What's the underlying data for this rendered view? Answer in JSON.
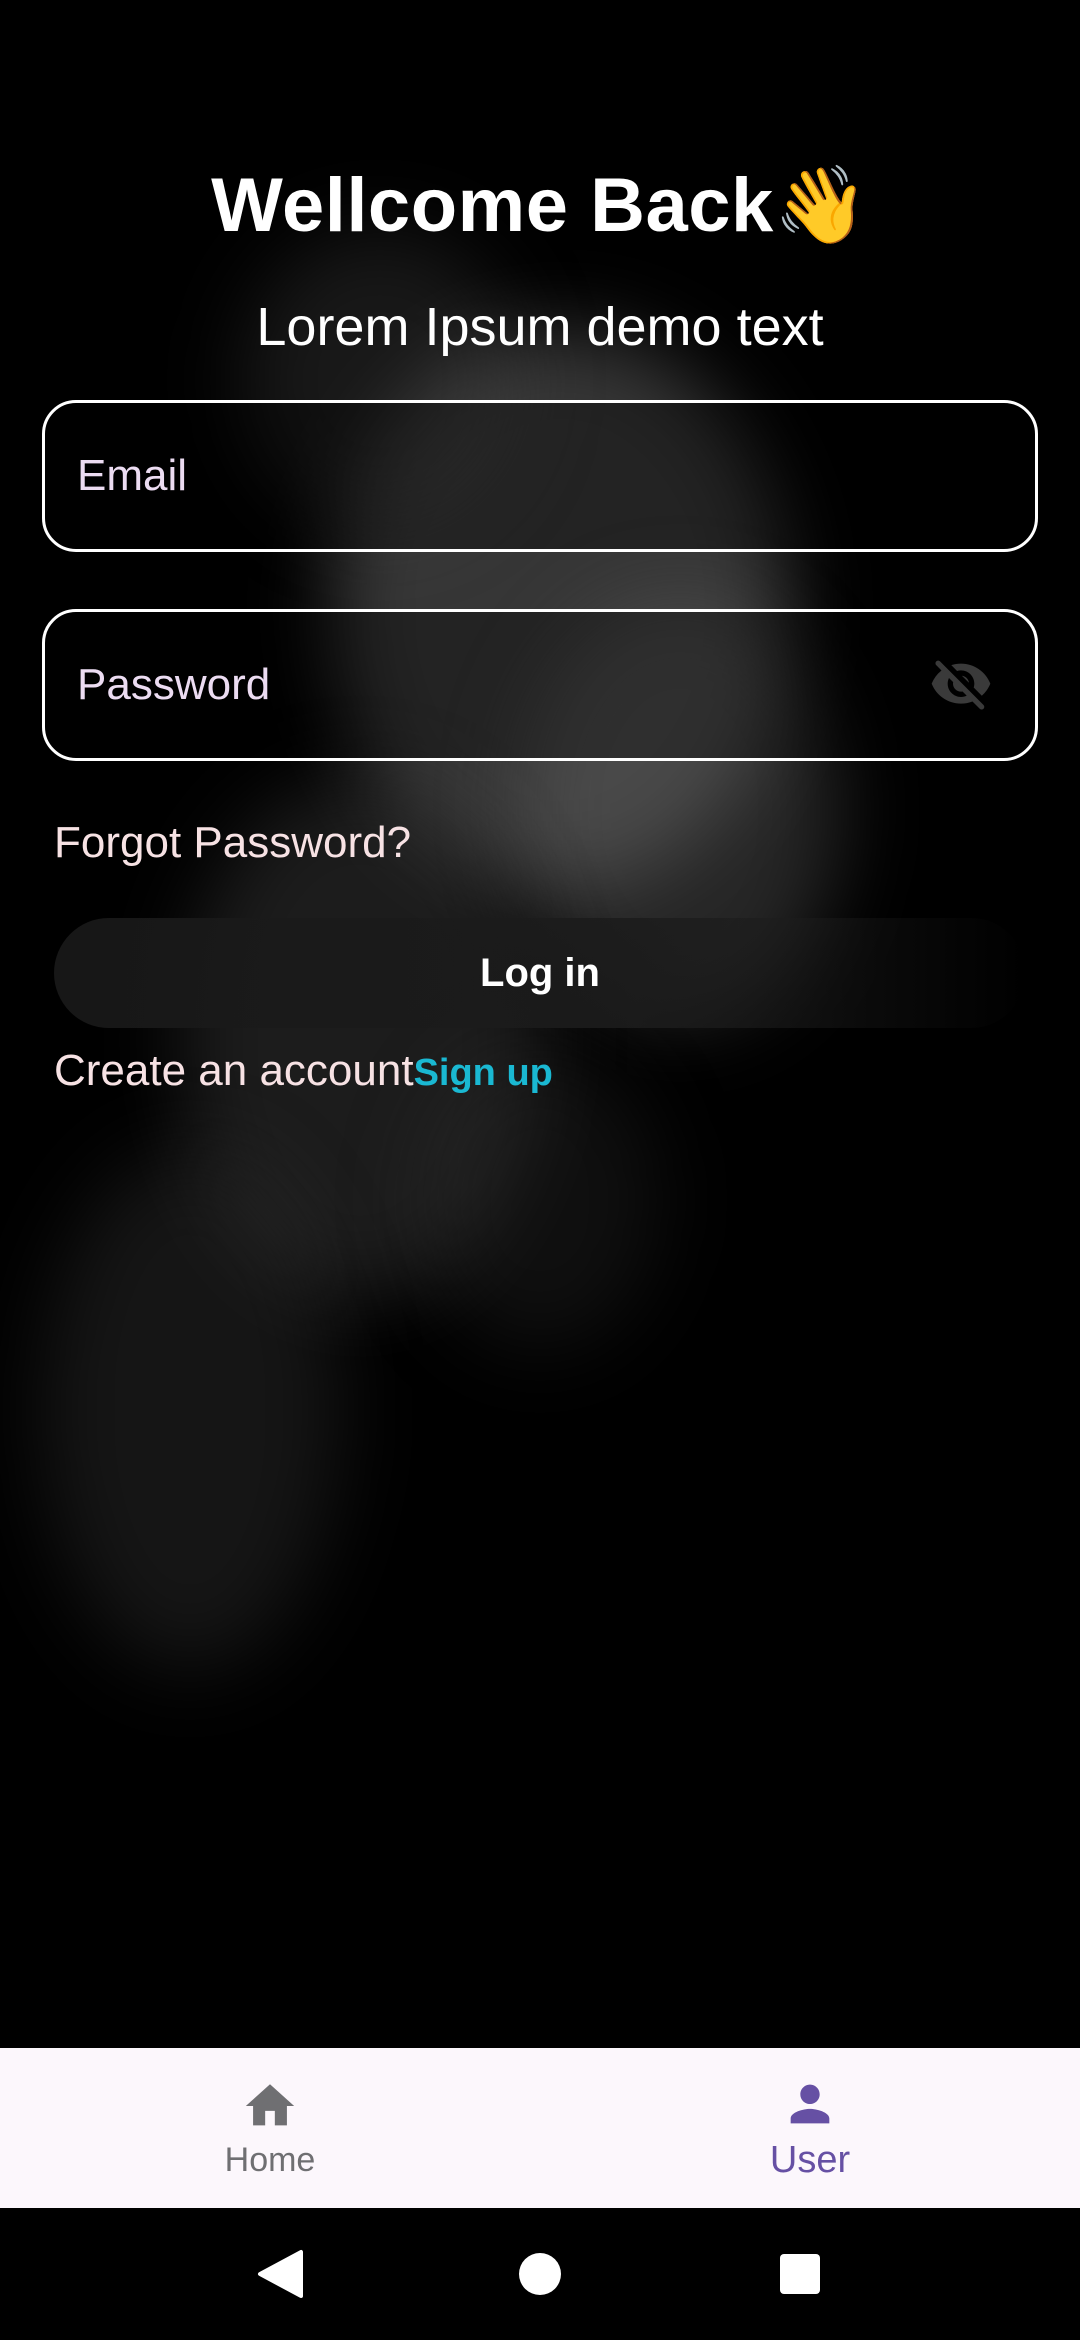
{
  "header": {
    "title": "Wellcome Back",
    "title_emoji": "👋",
    "subtitle": "Lorem Ipsum demo text"
  },
  "form": {
    "email_placeholder": "Email",
    "email_value": "",
    "password_placeholder": "Password",
    "password_value": "",
    "password_visibility_icon": "eye-off-icon",
    "forgot_label": "Forgot Password?",
    "login_label": "Log in",
    "create_account_text": "Create an account",
    "signup_label": "Sign up"
  },
  "bottom_nav": {
    "items": [
      {
        "label": "Home",
        "icon": "home-icon",
        "selected": false
      },
      {
        "label": "User",
        "icon": "person-icon",
        "selected": true
      }
    ]
  },
  "system_nav": {
    "back_icon": "back-triangle-icon",
    "home_icon": "home-circle-icon",
    "recents_icon": "recents-square-icon"
  },
  "colors": {
    "background": "#000000",
    "text_primary": "#ffffff",
    "link_accent": "#1ab8d2",
    "nav_background": "#fcf7fc",
    "nav_selected": "#6650a4",
    "nav_unselected": "#6f6f72"
  }
}
